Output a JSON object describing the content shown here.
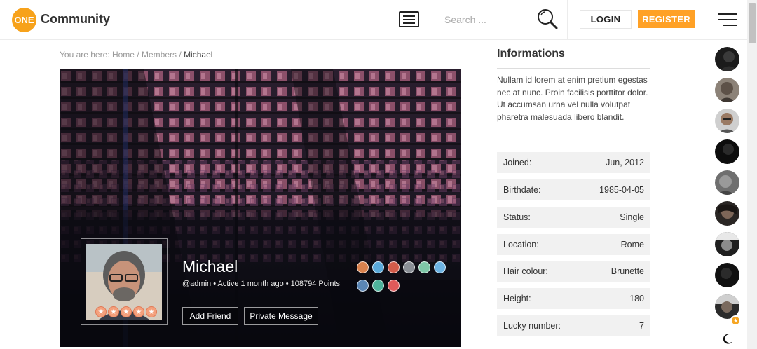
{
  "header": {
    "logo_badge": "ONE",
    "logo_text": "Community",
    "search_placeholder": "Search ...",
    "login_label": "LOGIN",
    "register_label": "REGISTER"
  },
  "breadcrumb": {
    "prefix": "You are here:",
    "home": "Home",
    "members": "Members",
    "current": "Michael",
    "separator": "/"
  },
  "profile": {
    "name": "Michael",
    "handle": "@admin",
    "activity": "Active 1 month ago",
    "points": "108794 Points",
    "bullet": "•",
    "rating_stars": 5,
    "add_friend_label": "Add Friend",
    "private_message_label": "Private Message"
  },
  "info": {
    "title": "Informations",
    "description": "Nullam id lorem at enim pretium egestas nec at nunc. Proin facilisis porttitor dolor. Ut accumsan urna vel nulla volutpat pharetra malesuada libero blandit.",
    "rows": [
      {
        "label": "Joined:",
        "value": "Jun, 2012"
      },
      {
        "label": "Birthdate:",
        "value": "1985-04-05"
      },
      {
        "label": "Status:",
        "value": "Single"
      },
      {
        "label": "Location:",
        "value": "Rome"
      },
      {
        "label": "Hair colour:",
        "value": "Brunette"
      },
      {
        "label": "Height:",
        "value": "180"
      },
      {
        "label": "Lucky number:",
        "value": "7"
      }
    ]
  },
  "colors": {
    "accent": "#ffa126",
    "logo": "#f7a21b"
  }
}
